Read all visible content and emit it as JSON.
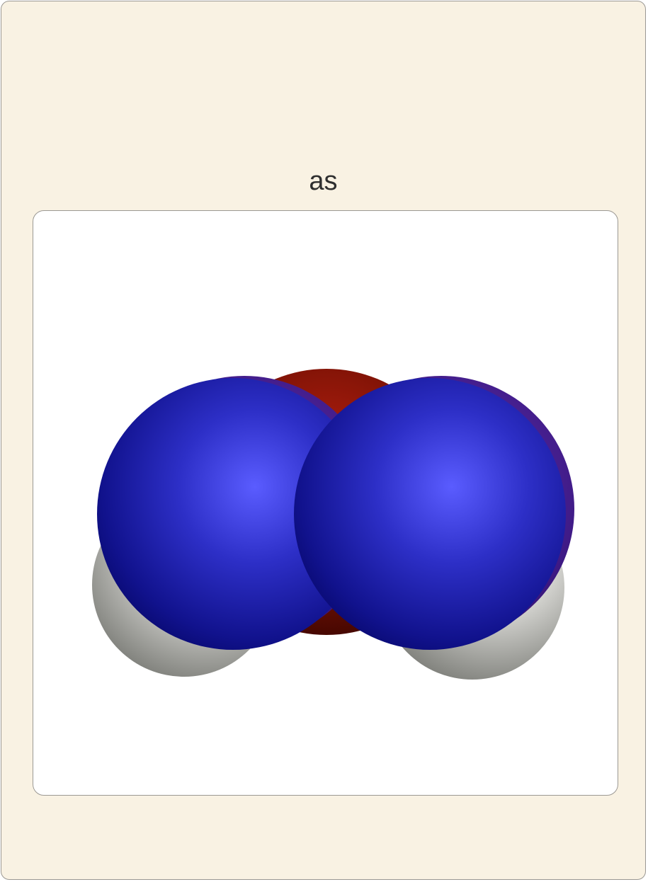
{
  "card": {
    "title": "as"
  },
  "molecule": {
    "atoms": [
      {
        "element": "H",
        "color": "#ffffff"
      },
      {
        "element": "H",
        "color": "#ffffff"
      },
      {
        "element": "O",
        "color": "#ff0000"
      },
      {
        "element": "N",
        "color": "#6b2fb0"
      },
      {
        "element": "N",
        "color": "#6b2fb0"
      },
      {
        "element": "N",
        "color": "#5b5bff"
      },
      {
        "element": "N",
        "color": "#5b5bff"
      }
    ]
  }
}
